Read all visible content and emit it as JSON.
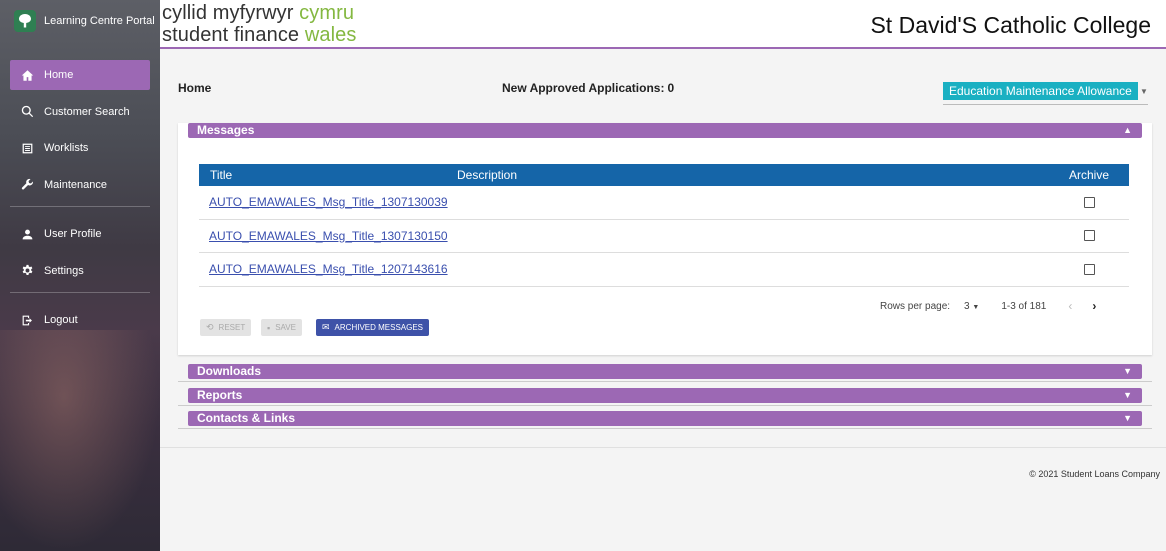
{
  "sidebar": {
    "app_title": "Learning Centre Portal",
    "logo_icon": "tree-icon",
    "items": [
      {
        "label": "Home",
        "icon": "home-icon",
        "active": true
      },
      {
        "label": "Customer Search",
        "icon": "search-icon"
      },
      {
        "label": "Worklists",
        "icon": "list-icon"
      },
      {
        "label": "Maintenance",
        "icon": "wrench-icon"
      },
      {
        "label": "User Profile",
        "icon": "person-icon"
      },
      {
        "label": "Settings",
        "icon": "gear-icon"
      },
      {
        "label": "Logout",
        "icon": "logout-icon"
      }
    ]
  },
  "header": {
    "brand_line1_a": "cyllid myfyrwyr",
    "brand_line1_b": "cymru",
    "brand_line2_a": "student finance",
    "brand_line2_b": "wales",
    "college": "St David'S Catholic College"
  },
  "main": {
    "page_title": "Home",
    "new_apps_label": "New Approved Applications:",
    "new_apps_count": "0",
    "scheme_select": "Education Maintenance Allowance"
  },
  "messages": {
    "label": "Messages",
    "columns": {
      "title": "Title",
      "description": "Description",
      "archive": "Archive"
    },
    "rows": [
      {
        "title": "AUTO_EMAWALES_Msg_Title_1307130039"
      },
      {
        "title": "AUTO_EMAWALES_Msg_Title_1307130150"
      },
      {
        "title": "AUTO_EMAWALES_Msg_Title_1207143616"
      }
    ],
    "pager": {
      "rows_per_page_label": "Rows per page:",
      "rows_per_page": "3",
      "range": "1-3 of 181"
    },
    "buttons": {
      "reset": "RESET",
      "save": "SAVE",
      "archived": "ARCHIVED MESSAGES"
    }
  },
  "sections": {
    "downloads": "Downloads",
    "reports": "Reports",
    "contacts": "Contacts & Links"
  },
  "footer": {
    "copyright": "© 2021 Student Loans Company"
  },
  "colors": {
    "accent": "#9c68b4",
    "table_header": "#1565a8",
    "select": "#1ab0c2",
    "brand_green": "#84b841"
  }
}
